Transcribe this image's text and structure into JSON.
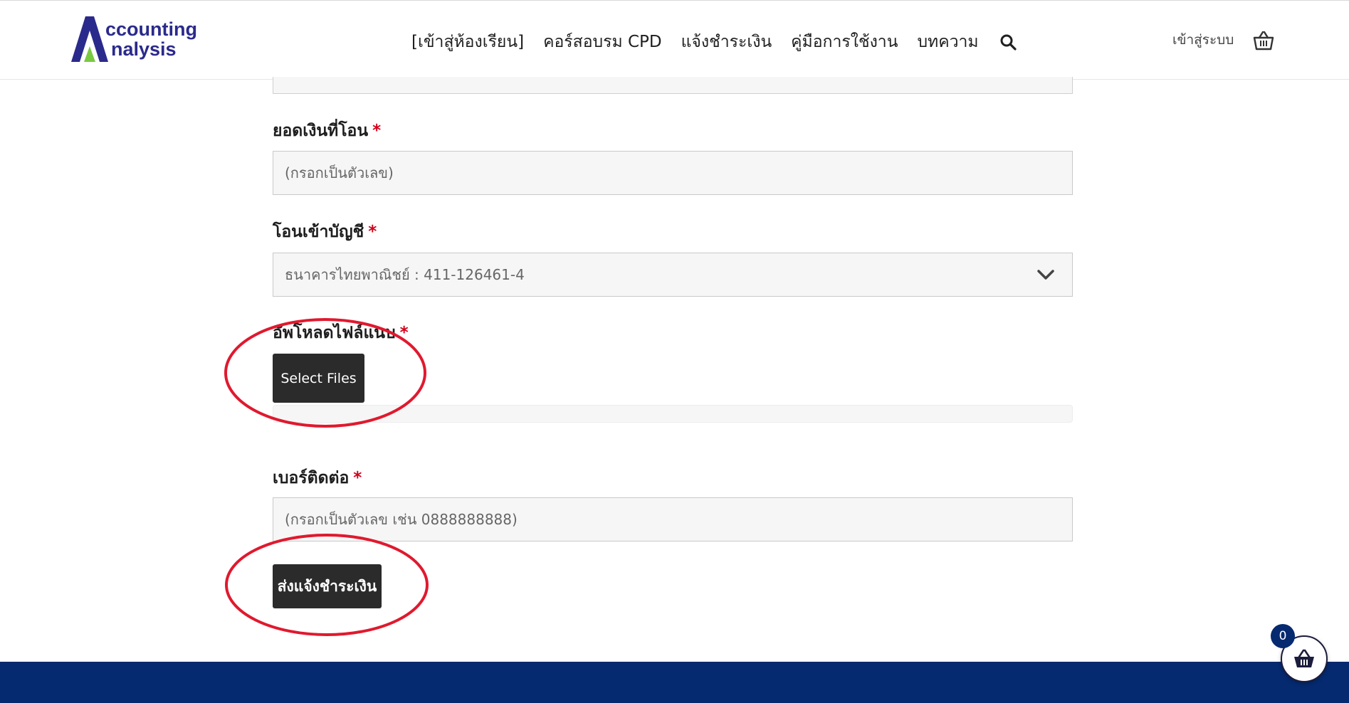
{
  "header": {
    "logo": {
      "line1": "ccounting",
      "line2": "nalysis",
      "letter": "A"
    },
    "nav": [
      {
        "label": "[เข้าสู่ห้องเรียน]"
      },
      {
        "label": "คอร์สอบรม CPD"
      },
      {
        "label": "แจ้งชำระเงิน"
      },
      {
        "label": "คู่มือการใช้งาน"
      },
      {
        "label": "บทความ"
      }
    ],
    "search_icon": "search-icon",
    "login_label": "เข้าสู่ระบบ",
    "cart_icon": "basket-icon"
  },
  "form": {
    "amount": {
      "label": "ยอดเงินที่โอน",
      "required": "*",
      "placeholder": "(กรอกเป็นตัวเลข)",
      "value": ""
    },
    "account": {
      "label": "โอนเข้าบัญชี",
      "required": "*",
      "selected": "ธนาคารไทยพาณิชย์ : 411-126461-4"
    },
    "upload": {
      "label": "อัพโหลดไฟล์แนบ",
      "required": "*",
      "button": "Select Files",
      "progress": 0
    },
    "phone": {
      "label": "เบอร์ติดต่อ",
      "required": "*",
      "placeholder": "(กรอกเป็นตัวเลข เช่น 0888888888)",
      "value": ""
    },
    "submit_label": "ส่งแจ้งชำระเงิน"
  },
  "floating_cart": {
    "count": "0",
    "icon": "basket-icon"
  },
  "colors": {
    "accent_dark": "#2b2b2b",
    "required": "#d0021b",
    "footer": "#052a70",
    "highlight_circle": "#e0192e",
    "logo_blue": "#2a2a8c",
    "logo_green": "#7ac943"
  }
}
